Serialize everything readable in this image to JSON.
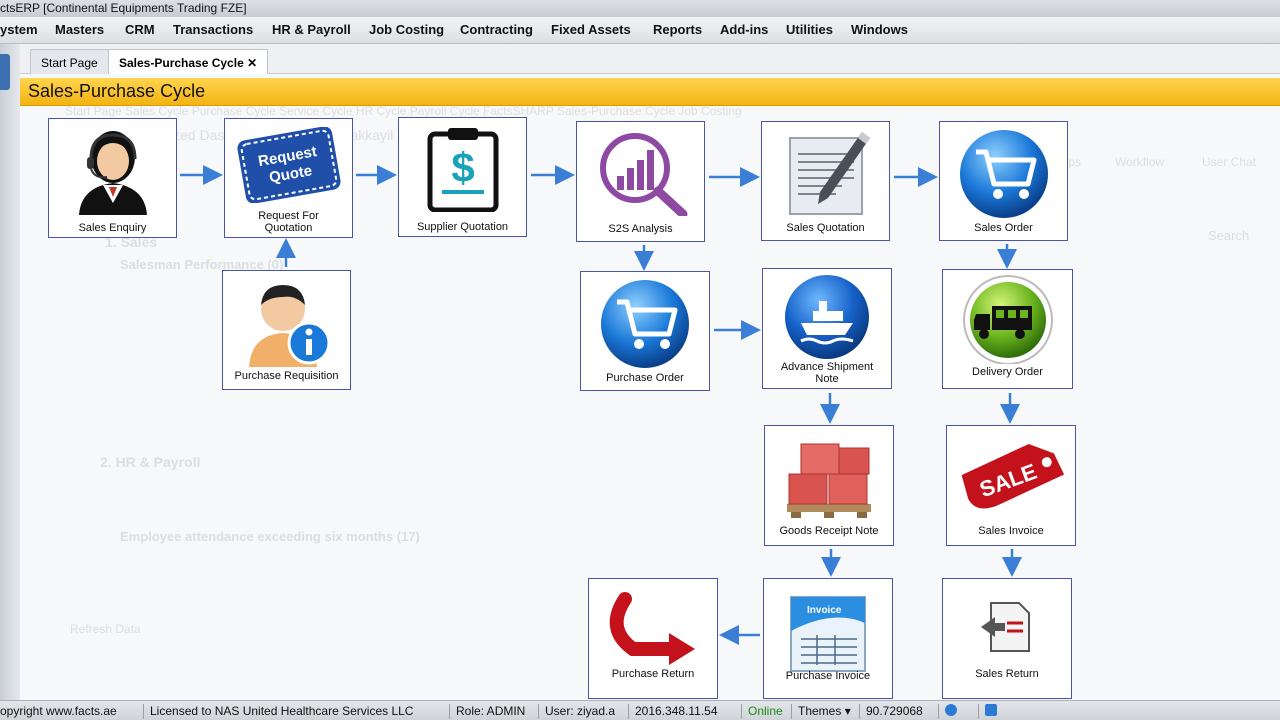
{
  "app": {
    "title": "ctsERP [Continental Equipments Trading FZE]"
  },
  "menu": [
    "ystem",
    "Masters",
    "CRM",
    "Transactions",
    "HR & Payroll",
    "Job Costing",
    "Contracting",
    "Fixed Assets",
    "Reports",
    "Add-ins",
    "Utilities",
    "Windows"
  ],
  "tabs": {
    "start": "Start Page",
    "active": "Sales-Purchase Cycle",
    "close": "✕"
  },
  "header": {
    "title": "Sales-Purchase Cycle"
  },
  "background": {
    "menu_ghost": "System   Masters   CRM   Transactions   HR & Payroll   Job Costing   Contracting   Fixed Assets   Reports   Add-ins   Utilities   Windows",
    "subtabs": "Start Page   Sales Cycle   Purchase Cycle   Service Cycle   HR Cycle   Payroll Cycle   FactsSHARP   Sales-Purchase Cycle   Job Costing",
    "dashboard_title": "FactsERP Customized Dashboard of Ziyad Kanakkayil",
    "section_sales": "1. Sales",
    "salesman_performance": "Salesman Performance (0)",
    "section_hr": "2. HR & Payroll",
    "attendance": "Employee attendance exceeding six months (17)",
    "refresh": "Refresh Data",
    "search": "Search",
    "workflow": "Workflow",
    "user_chat": "User Chat",
    "followups": "Follow-ups",
    "favorites": "Favorites"
  },
  "nodes": {
    "sales_enquiry": "Sales Enquiry",
    "request_quote": "Request For Quotation",
    "request_quote_icon": "Request Quote",
    "supplier_quotation": "Supplier Quotation",
    "s2s_analysis": "S2S Analysis",
    "sales_quotation": "Sales Quotation",
    "sales_order": "Sales Order",
    "purchase_requisition": "Purchase Requisition",
    "purchase_order": "Purchase Order",
    "advance_shipment": "Advance Shipment Note",
    "delivery_order": "Delivery Order",
    "goods_receipt": "Goods Receipt Note",
    "sales_invoice": "Sales Invoice",
    "sale_tag": "SALE",
    "purchase_return": "Purchase Return",
    "purchase_invoice": "Purchase Invoice",
    "invoice_tag": "Invoice",
    "sales_return": "Sales Return"
  },
  "status": {
    "copyright": "opyright www.facts.ae",
    "license": "Licensed to NAS United Healthcare Services LLC",
    "role": "Role: ADMIN",
    "user": "User: ziyad.a",
    "version": "2016.348.11.54",
    "online": "Online",
    "themes": "Themes",
    "zoom": "90.729068"
  },
  "colors": {
    "accent_blue": "#3a7fd5",
    "header_orange": "#f5b81c",
    "online_green": "#1a8a1a"
  }
}
